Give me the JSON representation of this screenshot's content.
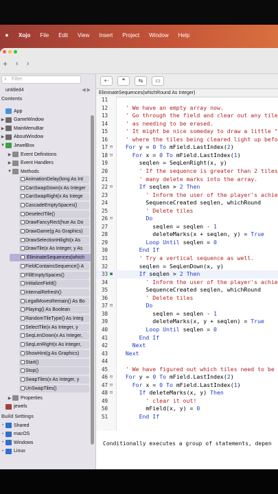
{
  "menubar": {
    "apple": "",
    "items": [
      "Xojo",
      "File",
      "Edit",
      "View",
      "Insert",
      "Project",
      "Window",
      "Help"
    ]
  },
  "toolbar": {
    "add": "+",
    "back": "‹",
    "forward": "›"
  },
  "sidebar": {
    "filter_placeholder": "Filter",
    "tab_name": "untitled4",
    "tab_arrows": "◀ ▶",
    "contents_label": "Contents",
    "tree": [
      {
        "label": "App",
        "icon_color": "#4a8fe0",
        "depth": 0,
        "arrow": ""
      },
      {
        "label": "GameWindow",
        "icon_color": "#6a6a6a",
        "depth": 0,
        "arrow": "▶"
      },
      {
        "label": "MainMenuBar",
        "icon_color": "#6a6a6a",
        "depth": 0,
        "arrow": "▶"
      },
      {
        "label": "AboutWindow",
        "icon_color": "#6a6a6a",
        "depth": 0,
        "arrow": "▶"
      },
      {
        "label": "JewelBox",
        "icon_color": "#3f9e4a",
        "depth": 0,
        "arrow": "▼"
      },
      {
        "label": "Event Definitions",
        "icon_color": "#8a8a8a",
        "depth": 1,
        "arrow": "▶"
      },
      {
        "label": "Event Handlers",
        "icon_color": "#8a8a8a",
        "depth": 1,
        "arrow": "▶"
      },
      {
        "label": "Methods",
        "icon_color": "#8a8a8a",
        "depth": 1,
        "arrow": "▼"
      }
    ],
    "methods": [
      "AnimationDelay(long As Int",
      "CanSwapDown(x As Integer",
      "CanSwapRight(x As Intege",
      "CascadeEmptySpaces()",
      "DeselectTile()",
      "DrawFancyRect(hue As Do",
      "DrawGame(g As Graphics)",
      "DrawSelectionHilight(x As",
      "DrawTile(x As Integer, y As",
      "EliminateSequences(which",
      "FieldContainsSequence() A",
      "FillEmptySpaces()",
      "InitializeField()",
      "InternalRefresh()",
      "LegalMovesRemain() As Bo",
      "Playing() As Boolean",
      "RandomTileType() As Integ",
      "SelectTile(x As Integer, y",
      "SeqLenDown(x As Integer,",
      "SeqLenRight(x As Integer,",
      "ShowHint(g As Graphics)",
      "Start()",
      "Stop()",
      "SwapTiles(x As Integer, y",
      "UnSwapTiles()"
    ],
    "after": [
      {
        "label": "Properties",
        "icon_color": "#8a8a8a",
        "depth": 1,
        "arrow": "▶"
      },
      {
        "label": "jewels",
        "icon_color": "#a04040",
        "depth": 0,
        "arrow": ""
      }
    ],
    "build_label": "Build Settings",
    "build": [
      "Shared",
      "macOS",
      "Windows",
      "Linux"
    ]
  },
  "editor": {
    "breadcrumb": "EliminateSequences(whichRound As Integer)",
    "status": "Conditionally executes a group of statements, depen"
  },
  "code_lines": [
    {
      "n": "11",
      "t": ""
    },
    {
      "n": "12",
      "t": "  ' We have an empty array now.",
      "cls": "c-comment"
    },
    {
      "n": "13",
      "t": "  ' Go through the field and clear out any tiles",
      "cls": "c-comment"
    },
    {
      "n": "14",
      "t": "  ' as needing to be erased.",
      "cls": "c-comment"
    },
    {
      "n": "15",
      "t": "  ' It might be nice someday to draw a little \"s",
      "cls": "c-comment"
    },
    {
      "n": "16",
      "t": "  ' where the tiles being cleared light up befor",
      "cls": "c-comment"
    },
    {
      "n": "17",
      "t": "  For y = 0 To mField.LastIndex(2)",
      "mk": "⊟"
    },
    {
      "n": "18",
      "t": "    For x = 0 To mField.LastIndex(1)",
      "mk": "⊟"
    },
    {
      "n": "19",
      "t": "      seqlen = SeqLenRight(x, y)"
    },
    {
      "n": "20",
      "t": "      ' If the sequence is greater than 2 tiles",
      "cls": "c-comment"
    },
    {
      "n": "21",
      "t": "      ' many delete marks into the array.",
      "cls": "c-comment"
    },
    {
      "n": "22",
      "t": "      If seqlen > 2 Then",
      "mk": "⊟"
    },
    {
      "n": "23",
      "t": "        ' Inform the user of the player's achiev",
      "cls": "c-comment"
    },
    {
      "n": "24",
      "t": "        SequenceCreated seqlen, whichRound"
    },
    {
      "n": "25",
      "t": "        ' Delete tiles",
      "cls": "c-comment"
    },
    {
      "n": "26",
      "t": "        Do",
      "mk": "⊟"
    },
    {
      "n": "27",
      "t": "          seqlen = seqlen - 1"
    },
    {
      "n": "28",
      "t": "          deleteMarks(x + seqlen, y) = True"
    },
    {
      "n": "29",
      "t": "        Loop Until seqlen = 0"
    },
    {
      "n": "30",
      "t": "      End If"
    },
    {
      "n": "31",
      "t": "      ' Try a vertical sequence as well.",
      "cls": "c-comment"
    },
    {
      "n": "32",
      "t": "      seqlen = SeqLenDown(x, y)"
    },
    {
      "n": "33",
      "t": "      If seqlen > 2 Then",
      "mk": "◼",
      "hl": true
    },
    {
      "n": "34",
      "t": "        ' Inform the user of the player's achiev",
      "cls": "c-comment"
    },
    {
      "n": "35",
      "t": "        SequenceCreated seqlen, whichRound"
    },
    {
      "n": "36",
      "t": "        ' Delete tiles",
      "cls": "c-comment"
    },
    {
      "n": "37",
      "t": "        Do",
      "mk": "⊟"
    },
    {
      "n": "38",
      "t": "          seqlen = seqlen - 1"
    },
    {
      "n": "39",
      "t": "          deleteMarks(x, y + seqlen) = True"
    },
    {
      "n": "40",
      "t": "        Loop Until seqlen = 0"
    },
    {
      "n": "41",
      "t": "      End If"
    },
    {
      "n": "42",
      "t": "    Next"
    },
    {
      "n": "43",
      "t": "  Next"
    },
    {
      "n": "44",
      "t": ""
    },
    {
      "n": "45",
      "t": "  ' We have figured out which tiles need to be d",
      "cls": "c-comment"
    },
    {
      "n": "46",
      "t": "  For y = 0 To mField.LastIndex(2)",
      "mk": "⊟"
    },
    {
      "n": "47",
      "t": "    For x = 0 To mField.LastIndex(1)",
      "mk": "⊟"
    },
    {
      "n": "48",
      "t": "      If deleteMarks(x, y) Then",
      "mk": "⊟"
    },
    {
      "n": "49",
      "t": "        ' clear it out!",
      "cls": "c-comment"
    },
    {
      "n": "50",
      "t": "        mField(x, y) = 0"
    },
    {
      "n": "51",
      "t": "      End If"
    }
  ]
}
